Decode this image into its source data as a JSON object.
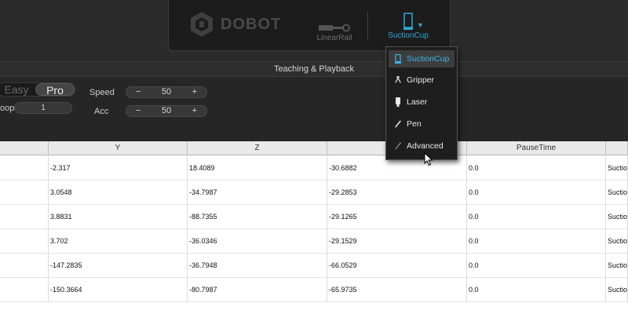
{
  "header": {
    "brand": "DOBOT",
    "tools": [
      {
        "label": "LinearRail"
      },
      {
        "label": "SuctionCup"
      }
    ],
    "dropdown_arrow": "▼"
  },
  "section": {
    "title": "Teaching & Playback"
  },
  "controls": {
    "mode": {
      "easy": "Easy",
      "pro": "Pro",
      "selected": "Pro"
    },
    "loop": {
      "label": "oop",
      "value": "1"
    },
    "speed": {
      "label": "Speed",
      "value": "50",
      "minus": "−",
      "plus": "+"
    },
    "acc": {
      "label": "Acc",
      "value": "50",
      "minus": "−",
      "plus": "+"
    }
  },
  "table": {
    "headers": [
      "",
      "Y",
      "Z",
      "",
      "PauseTime",
      ""
    ],
    "rows": [
      [
        "",
        "-2.317",
        "18.4089",
        "-30.6882",
        "0.0",
        "Suction"
      ],
      [
        "",
        "3.0548",
        "-34.7987",
        "-29.2853",
        "0.0",
        "Suction"
      ],
      [
        "",
        "3.8831",
        "-88.7355",
        "-29.1265",
        "0.0",
        "Suction"
      ],
      [
        "",
        "3.702",
        "-36.0346",
        "-29.1529",
        "0.0",
        "Suction"
      ],
      [
        "",
        "-147.2835",
        "-36.7948",
        "-66.0529",
        "0.0",
        "Suction"
      ],
      [
        "",
        "-150.3664",
        "-80.7987",
        "-65.9735",
        "0.0",
        "Suction"
      ]
    ]
  },
  "tool_menu": {
    "items": [
      {
        "label": "SuctionCup",
        "icon": "suction-cup-icon",
        "selected": true
      },
      {
        "label": "Gripper",
        "icon": "gripper-icon",
        "selected": false
      },
      {
        "label": "Laser",
        "icon": "laser-icon",
        "selected": false
      },
      {
        "label": "Pen",
        "icon": "pen-icon",
        "selected": false
      },
      {
        "label": "Advanced",
        "icon": "advanced-icon",
        "selected": false
      }
    ]
  },
  "colors": {
    "accent": "#2fa7d8",
    "panel": "#1c1c1c",
    "background": "#262626"
  }
}
